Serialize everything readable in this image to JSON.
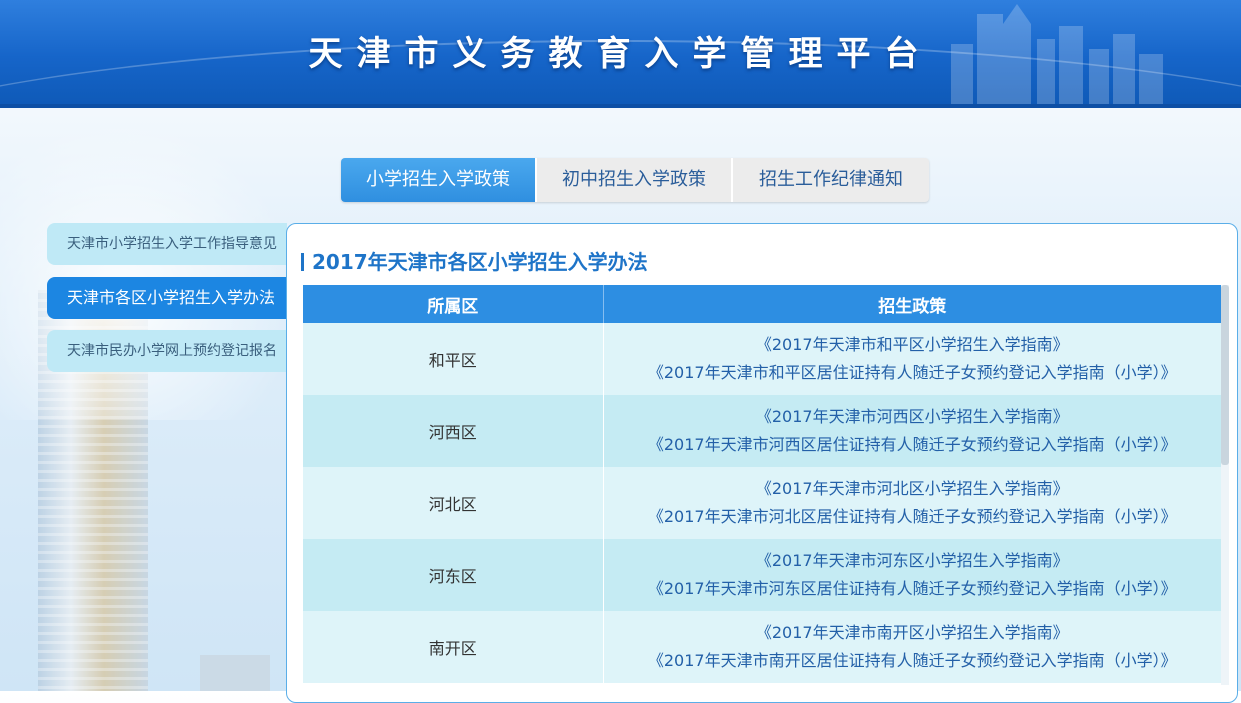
{
  "header": {
    "title": "天津市义务教育入学管理平台"
  },
  "tabs": [
    {
      "label": "小学招生入学政策",
      "active": true
    },
    {
      "label": "初中招生入学政策",
      "active": false
    },
    {
      "label": "招生工作纪律通知",
      "active": false
    }
  ],
  "sidebar": {
    "items": [
      {
        "label": "天津市小学招生入学工作指导意见",
        "active": false
      },
      {
        "label": "天津市各区小学招生入学办法",
        "active": true
      },
      {
        "label": "天津市民办小学网上预约登记报名",
        "active": false
      }
    ]
  },
  "content": {
    "heading": "2017年天津市各区小学招生入学办法",
    "columns": [
      "所属区",
      "招生政策"
    ],
    "rows": [
      {
        "district": "和平区",
        "links": [
          "《2017年天津市和平区小学招生入学指南》",
          "《2017年天津市和平区居住证持有人随迁子女预约登记入学指南（小学）》"
        ]
      },
      {
        "district": "河西区",
        "links": [
          "《2017年天津市河西区小学招生入学指南》",
          "《2017年天津市河西区居住证持有人随迁子女预约登记入学指南（小学）》"
        ]
      },
      {
        "district": "河北区",
        "links": [
          "《2017年天津市河北区小学招生入学指南》",
          "《2017年天津市河北区居住证持有人随迁子女预约登记入学指南（小学）》"
        ]
      },
      {
        "district": "河东区",
        "links": [
          "《2017年天津市河东区小学招生入学指南》",
          "《2017年天津市河东区居住证持有人随迁子女预约登记入学指南（小学）》"
        ]
      },
      {
        "district": "南开区",
        "links": [
          "《2017年天津市南开区小学招生入学指南》",
          "《2017年天津市南开区居住证持有人随迁子女预约登记入学指南（小学）》"
        ]
      }
    ]
  },
  "colors": {
    "header": "#1665c9",
    "accent": "#2d8ee2",
    "row_light": "#def4f9",
    "row_dark": "#c5ebf3"
  }
}
